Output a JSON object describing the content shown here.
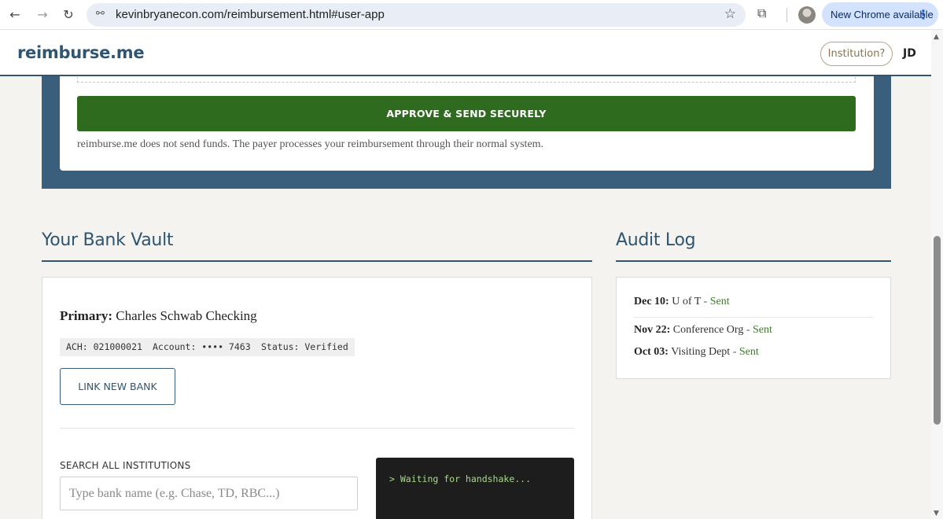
{
  "browser": {
    "url": "kevinbryanecon.com/reimbursement.html#user-app",
    "update_label": "New Chrome available",
    "back_glyph": "←",
    "forward_glyph": "→",
    "reload_glyph": "↻",
    "site_info_glyph": "⚯",
    "star_glyph": "☆",
    "extensions_glyph": "⧉",
    "menu_glyph": "⋮"
  },
  "header": {
    "brand": "reimburse.me",
    "institution_button": "Institution?",
    "user_initials": "JD"
  },
  "approve": {
    "button_label": "APPROVE & SEND SECURELY",
    "disclaimer": "reimburse.me does not send funds. The payer processes your reimbursement through their normal system."
  },
  "vault": {
    "title": "Your Bank Vault",
    "primary_label": "Primary:",
    "primary_value": "Charles Schwab Checking",
    "chips": {
      "ach": "ACH: 021000021",
      "account": "Account: •••• 7463",
      "status": "Status: Verified"
    },
    "link_button": "LINK NEW BANK",
    "search_label": "SEARCH ALL INSTITUTIONS",
    "search_placeholder": "Type bank name (e.g. Chase, TD, RBC...)",
    "terminal_text": "> Waiting for handshake..."
  },
  "audit": {
    "title": "Audit Log",
    "separator": "-",
    "entries": [
      {
        "date": "Dec 10:",
        "party": "U of T",
        "status": "Sent"
      },
      {
        "date": "Nov 22:",
        "party": "Conference Org",
        "status": "Sent"
      },
      {
        "date": "Oct 03:",
        "party": "Visiting Dept",
        "status": "Sent"
      }
    ]
  },
  "colors": {
    "brand": "#2f5571",
    "approve_green": "#2e6b1f",
    "status_green": "#3d7a2a",
    "panel_blue": "#3a5f7c"
  }
}
